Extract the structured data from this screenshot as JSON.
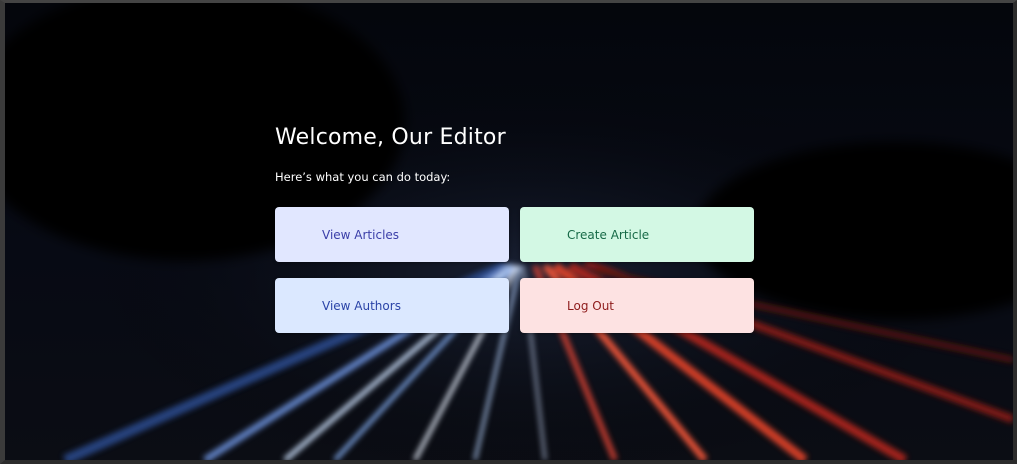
{
  "header": {
    "title": "Welcome, Our Editor",
    "subtitle": "Here’s what you can do today:"
  },
  "actions": [
    {
      "label": "View Articles",
      "color": "#e1e7ff"
    },
    {
      "label": "Create Article",
      "color": "#d3f8e4"
    },
    {
      "label": "View Authors",
      "color": "#dbe8ff"
    },
    {
      "label": "Log Out",
      "color": "#fde2e2"
    }
  ]
}
